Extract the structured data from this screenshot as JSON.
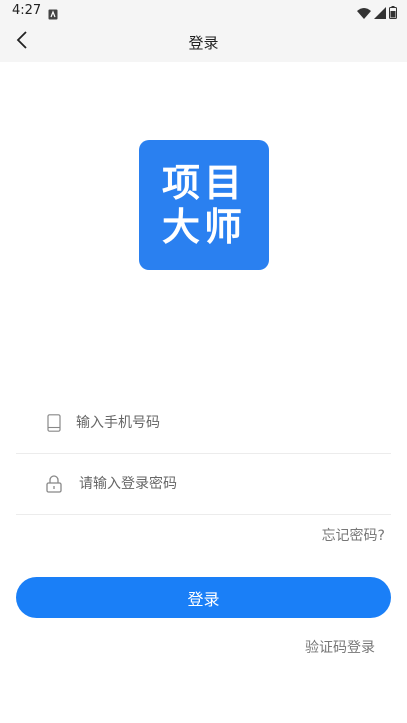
{
  "status_bar": {
    "time": "4:27",
    "icons": [
      "notification-icon",
      "wifi-icon",
      "signal-icon",
      "battery-icon"
    ]
  },
  "app_bar": {
    "title": "登录",
    "back_icon": "back-arrow-icon"
  },
  "logo": {
    "line1": "项目",
    "line2": "大师",
    "color": "#2a80f0"
  },
  "form": {
    "phone": {
      "placeholder": "输入手机号码",
      "value": "",
      "icon": "phone-icon"
    },
    "password": {
      "placeholder": "请输入登录密码",
      "value": "",
      "icon": "lock-icon"
    },
    "forgot_password": "忘记密码?",
    "login_button": "登录",
    "sms_login": "验证码登录"
  },
  "colors": {
    "accent": "#1a7ff7",
    "logo_bg": "#2a80f0",
    "secondary_text": "#777777"
  }
}
